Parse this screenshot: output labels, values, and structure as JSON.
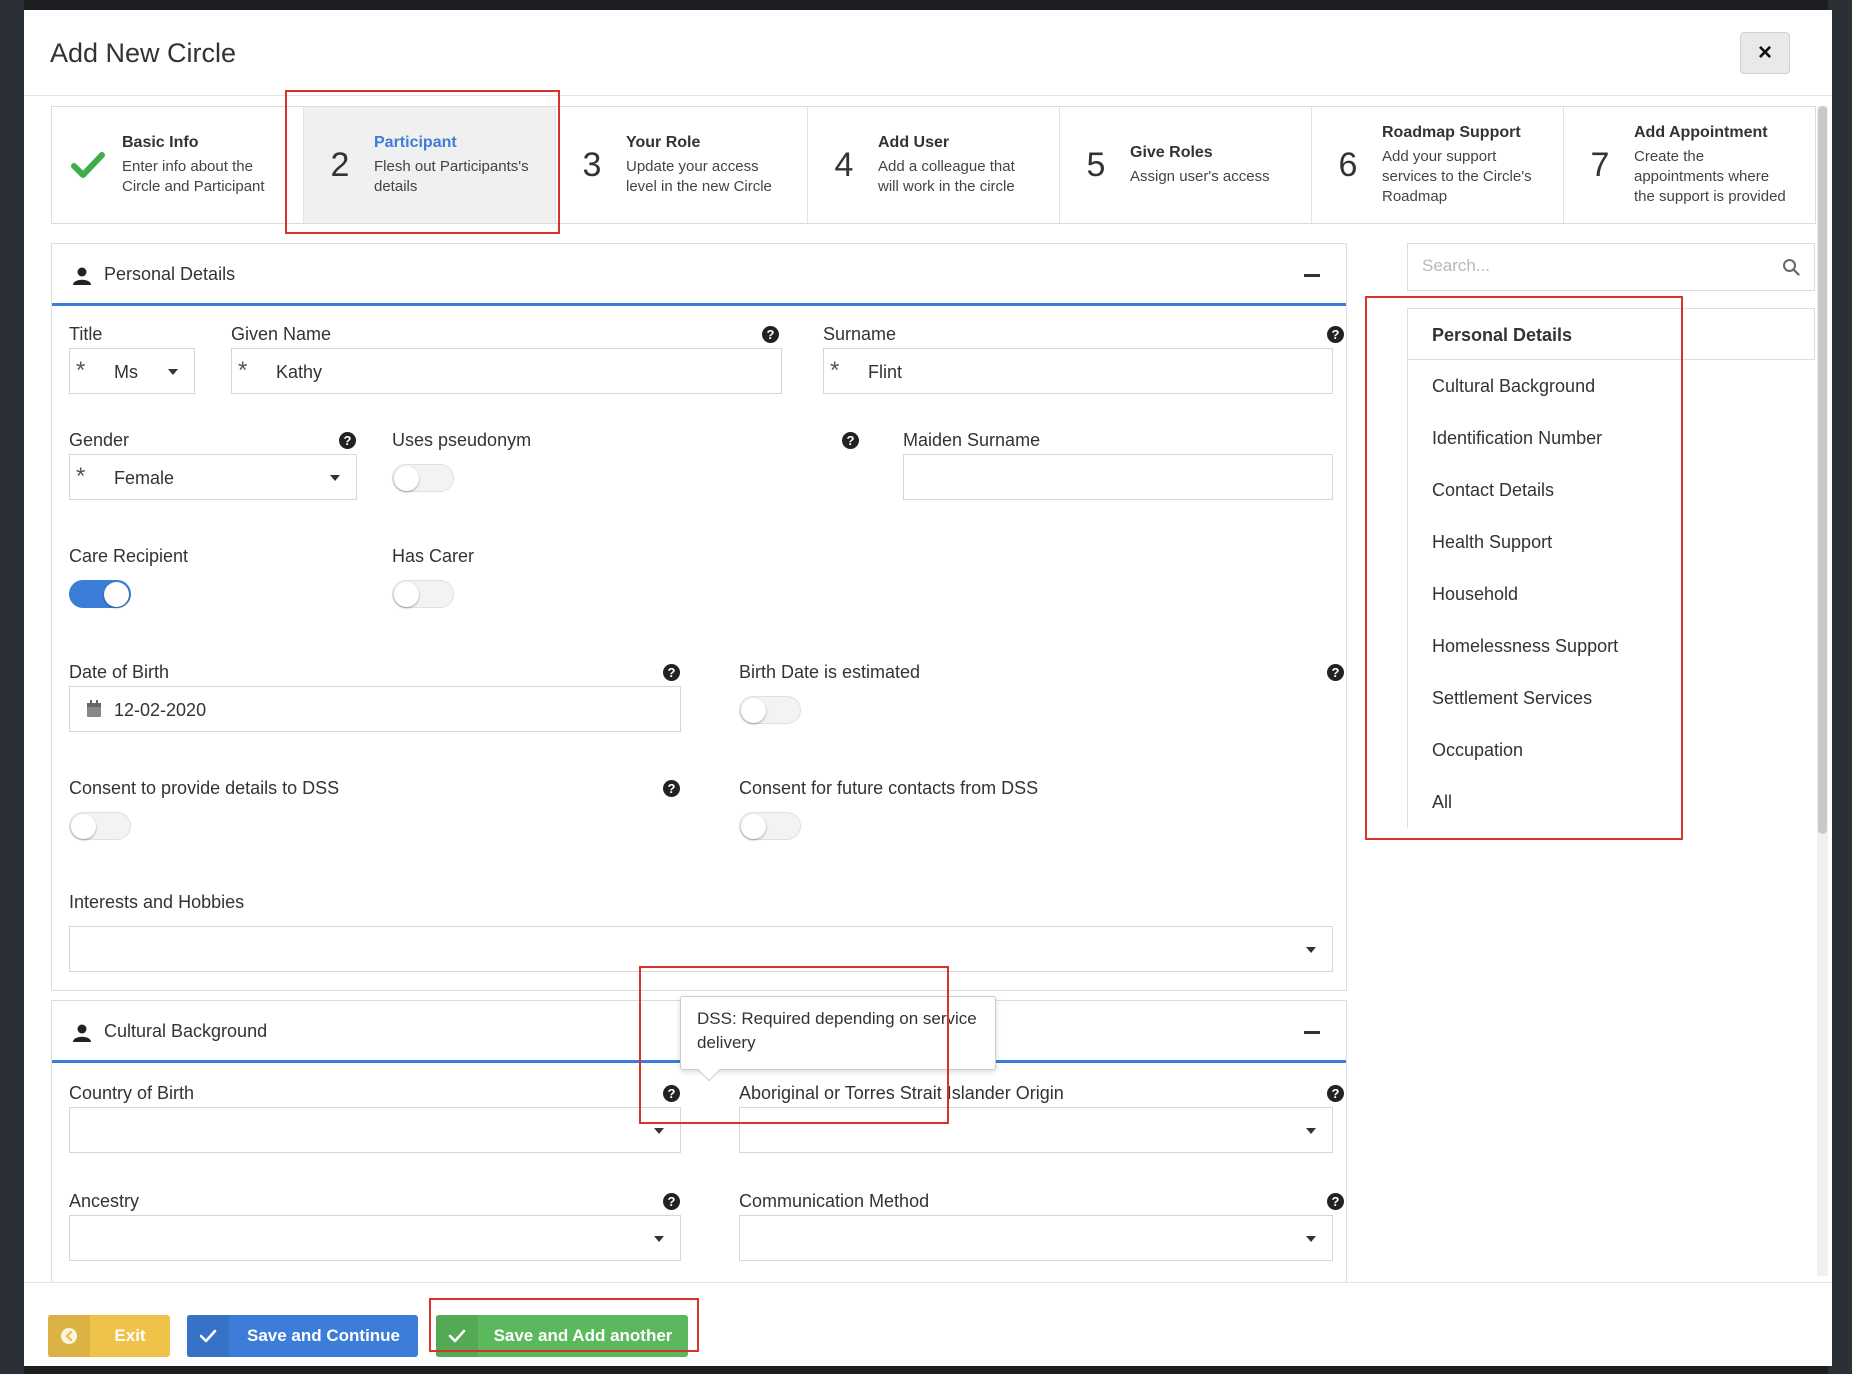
{
  "modal": {
    "title": "Add New Circle",
    "close_label": "×"
  },
  "steps": [
    {
      "num": "",
      "title": "Basic Info",
      "desc": "Enter info about the Circle and Participant",
      "done": true
    },
    {
      "num": "2",
      "title": "Participant",
      "desc": "Flesh out Participants's details",
      "active": true
    },
    {
      "num": "3",
      "title": "Your Role",
      "desc": "Update your access level in the new Circle"
    },
    {
      "num": "4",
      "title": "Add User",
      "desc": "Add a colleague that will work in the circle"
    },
    {
      "num": "5",
      "title": "Give Roles",
      "desc": "Assign user's access"
    },
    {
      "num": "6",
      "title": "Roadmap Support",
      "desc": "Add your support services to the Circle's Roadmap"
    },
    {
      "num": "7",
      "title": "Add Appointment",
      "desc": "Create the appointments where the support is provided"
    }
  ],
  "personal": {
    "header": "Personal Details",
    "title_label": "Title",
    "title_value": "Ms",
    "given_label": "Given Name",
    "given_value": "Kathy",
    "surname_label": "Surname",
    "surname_value": "Flint",
    "gender_label": "Gender",
    "gender_value": "Female",
    "pseudonym_label": "Uses pseudonym",
    "maiden_label": "Maiden Surname",
    "care_label": "Care Recipient",
    "carer_label": "Has Carer",
    "dob_label": "Date of Birth",
    "dob_value": "12-02-2020",
    "dob_est_label": "Birth Date is estimated",
    "consent_label": "Consent to provide details to DSS",
    "consent_future_label": "Consent for future contacts from DSS",
    "interests_label": "Interests and Hobbies"
  },
  "cultural": {
    "header": "Cultural Background",
    "country_label": "Country of Birth",
    "aboriginal_label": "Aboriginal or Torres Strait Islander Origin",
    "ancestry_label": "Ancestry",
    "communication_label": "Communication Method"
  },
  "tooltip": {
    "text": "DSS: Required depending on service delivery"
  },
  "search": {
    "placeholder": "Search..."
  },
  "nav": [
    "Personal Details",
    "Cultural Background",
    "Identification Number",
    "Contact Details",
    "Health Support",
    "Household",
    "Homelessness Support",
    "Settlement Services",
    "Occupation",
    "All"
  ],
  "footer": {
    "exit_label": "Exit",
    "continue_label": "Save and Continue",
    "add_label": "Save and Add another"
  },
  "colors": {
    "accent": "#3b7dd8",
    "success": "#5cb85c",
    "warning": "#efc24a",
    "highlight": "#d9322c"
  }
}
